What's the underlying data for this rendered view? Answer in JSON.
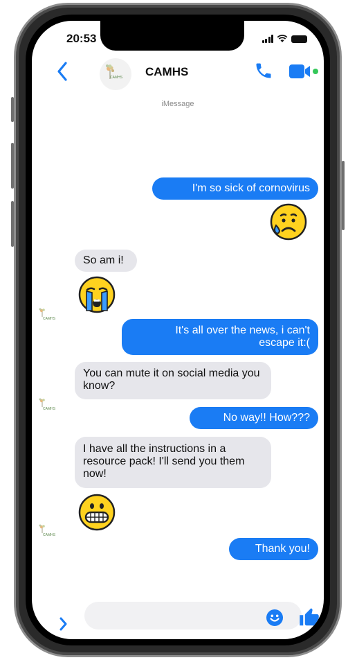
{
  "status_bar": {
    "time": "20:53"
  },
  "header": {
    "contact_name": "CAMHS",
    "avatar_logo_text": "CAMHS"
  },
  "service_label": "iMessage",
  "messages": [
    {
      "from": "me",
      "text": "I'm so sick of cornovirus"
    },
    {
      "from": "me",
      "emoji": "sad-tear-emoji"
    },
    {
      "from": "them",
      "text": "So am i!"
    },
    {
      "from": "them",
      "emoji": "crying-emoji"
    },
    {
      "from": "me",
      "text": "It's all over the news, i can't escape it:("
    },
    {
      "from": "them",
      "text": "You can mute it on social media you know?"
    },
    {
      "from": "me",
      "text": "No way!! How???"
    },
    {
      "from": "them",
      "text": "I have all the instructions in a resource pack! I'll send you them now!"
    },
    {
      "from": "them",
      "emoji": "grinning-emoji"
    },
    {
      "from": "me",
      "text": "Thank you!"
    }
  ],
  "colors": {
    "accent": "#1a7cf4",
    "received_bubble": "#e6e6eb",
    "online_dot": "#34c759"
  }
}
